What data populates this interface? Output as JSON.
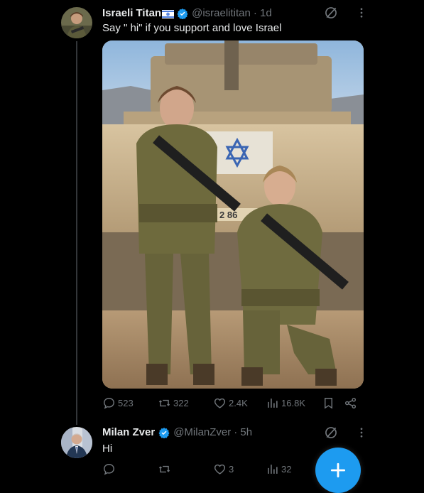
{
  "tweet": {
    "display_name": "Israeli Titan",
    "handle": "@israelititan",
    "time": "· 1d",
    "text": "Say \" hi\" if you support and love Israel",
    "media_tank_marking": "2 86",
    "stats": {
      "replies": "523",
      "reposts": "322",
      "likes": "2.4K",
      "views": "16.8K"
    }
  },
  "reply": {
    "display_name": "Milan Zver",
    "handle": "@MilanZver",
    "time": "· 5h",
    "text": "Hi",
    "stats": {
      "replies": "",
      "reposts": "",
      "likes": "3",
      "views": "32"
    }
  },
  "icons": {
    "verified": "verified-badge-icon",
    "grok": "grok-icon",
    "more": "more-icon",
    "reply": "reply-icon",
    "repost": "repost-icon",
    "like": "like-icon",
    "views": "views-icon",
    "bookmark": "bookmark-icon",
    "share": "share-icon",
    "compose": "compose-plus-icon",
    "flag": "israel-flag-icon"
  },
  "colors": {
    "background": "#000000",
    "text_primary": "#e7e9ea",
    "text_secondary": "#71767b",
    "accent": "#1d9bf0"
  }
}
